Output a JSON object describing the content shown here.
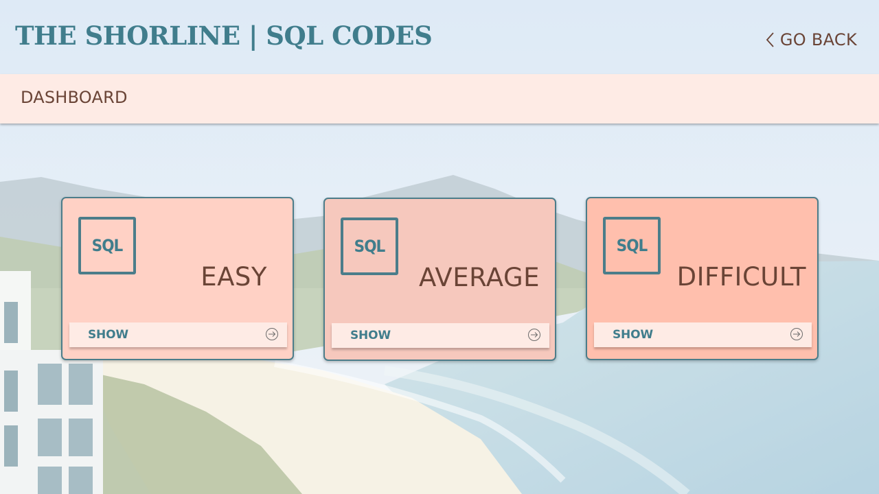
{
  "header": {
    "title": "THE SHORLINE | SQL CODES",
    "go_back_label": "GO BACK"
  },
  "dashboard": {
    "title": "DASHBOARD"
  },
  "cards": [
    {
      "badge": "SQL",
      "level": "EASY",
      "show_label": "SHOW",
      "color": "#ffd1c5"
    },
    {
      "badge": "SQL",
      "level": "AVERAGE",
      "show_label": "SHOW",
      "color": "#f6c8bd"
    },
    {
      "badge": "SQL",
      "level": "DIFFICULT",
      "show_label": "SHOW",
      "color": "#ffbfad"
    }
  ],
  "colors": {
    "title_teal": "#407d8c",
    "text_brown": "#6a4436",
    "bar_bg": "#feebe5",
    "card_border": "#4c7d8a"
  },
  "icons": {
    "back": "chevron-left-icon",
    "show": "arrow-circle-right-icon"
  }
}
